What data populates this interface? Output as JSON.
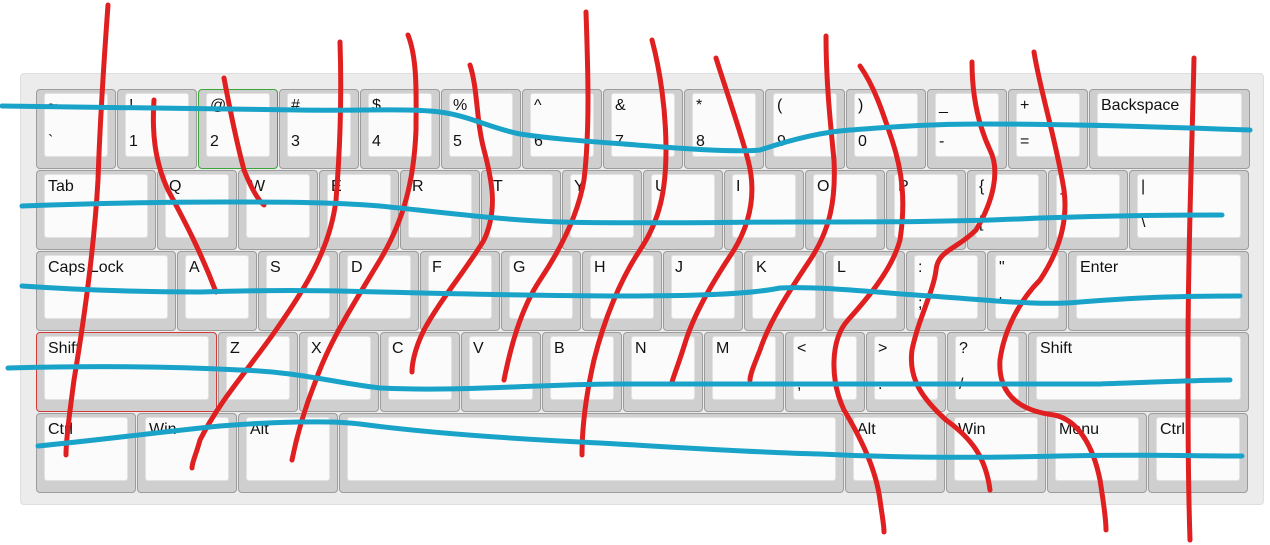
{
  "keyboard": {
    "rows": [
      [
        {
          "top": "~",
          "bottom": "`"
        },
        {
          "top": "!",
          "bottom": "1"
        },
        {
          "top": "@",
          "bottom": "2",
          "state": "green"
        },
        {
          "top": "#",
          "bottom": "3"
        },
        {
          "top": "$",
          "bottom": "4"
        },
        {
          "top": "%",
          "bottom": "5"
        },
        {
          "top": "^",
          "bottom": "6"
        },
        {
          "top": "&",
          "bottom": "7"
        },
        {
          "top": "*",
          "bottom": "8"
        },
        {
          "top": "(",
          "bottom": "9"
        },
        {
          "top": ")",
          "bottom": "0"
        },
        {
          "top": "_",
          "bottom": "-"
        },
        {
          "top": "+",
          "bottom": "="
        },
        {
          "main": "Backspace"
        }
      ],
      [
        {
          "main": "Tab"
        },
        {
          "main": "Q"
        },
        {
          "main": "W"
        },
        {
          "main": "E"
        },
        {
          "main": "R"
        },
        {
          "main": "T"
        },
        {
          "main": "Y"
        },
        {
          "main": "U"
        },
        {
          "main": "I"
        },
        {
          "main": "O"
        },
        {
          "main": "P"
        },
        {
          "top": "{",
          "bottom": "["
        },
        {
          "top": "}",
          "bottom": "]"
        },
        {
          "top": "|",
          "bottom": "\\"
        }
      ],
      [
        {
          "main": "Caps Lock"
        },
        {
          "main": "A"
        },
        {
          "main": "S"
        },
        {
          "main": "D"
        },
        {
          "main": "F"
        },
        {
          "main": "G"
        },
        {
          "main": "H"
        },
        {
          "main": "J"
        },
        {
          "main": "K"
        },
        {
          "main": "L"
        },
        {
          "top": ":",
          "bottom": ";"
        },
        {
          "top": "\"",
          "bottom": "'"
        },
        {
          "main": "Enter"
        }
      ],
      [
        {
          "main": "Shift",
          "state": "red"
        },
        {
          "main": "Z"
        },
        {
          "main": "X"
        },
        {
          "main": "C"
        },
        {
          "main": "V"
        },
        {
          "main": "B"
        },
        {
          "main": "N"
        },
        {
          "main": "M"
        },
        {
          "top": "<",
          "bottom": ","
        },
        {
          "top": ">",
          "bottom": "."
        },
        {
          "top": "?",
          "bottom": "/"
        },
        {
          "main": "Shift"
        }
      ],
      [
        {
          "main": "Ctrl"
        },
        {
          "main": "Win"
        },
        {
          "main": "Alt"
        },
        {
          "main": ""
        },
        {
          "main": "Alt"
        },
        {
          "main": "Win"
        },
        {
          "main": "Menu"
        },
        {
          "main": "Ctrl"
        }
      ]
    ]
  },
  "colors": {
    "red_scribble": "#e02020",
    "blue_scribble": "#1aa3c8",
    "pressed_green": "#3aa63a",
    "pressed_red": "#d33a3a"
  }
}
